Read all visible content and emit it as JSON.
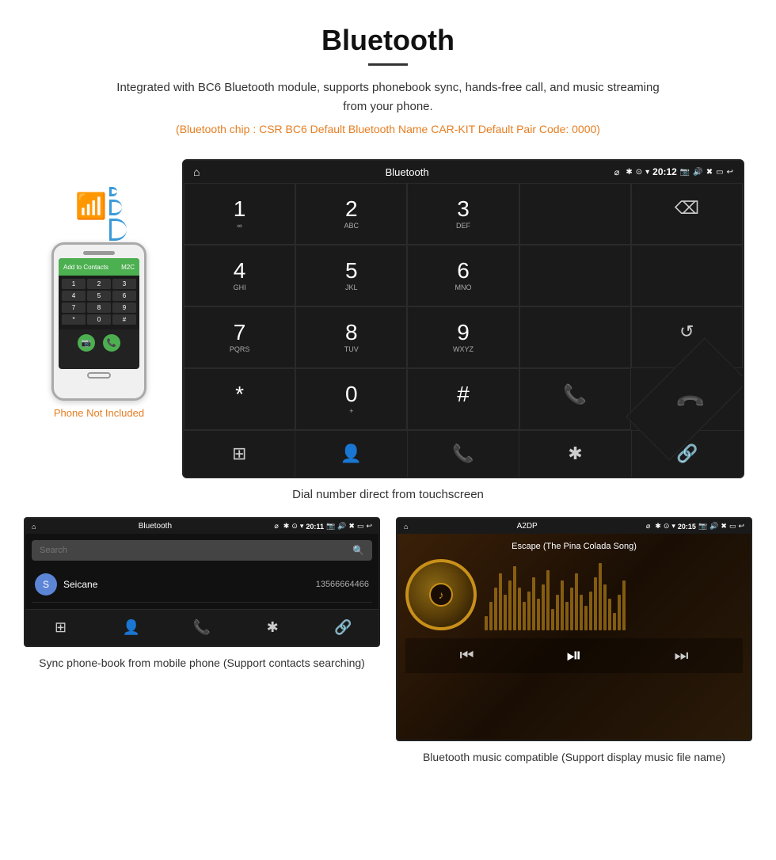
{
  "header": {
    "title": "Bluetooth",
    "description": "Integrated with BC6 Bluetooth module, supports phonebook sync, hands-free call, and music streaming from your phone.",
    "bluetooth_info": "(Bluetooth chip : CSR BC6    Default Bluetooth Name CAR-KIT    Default Pair Code: 0000)"
  },
  "main_screen": {
    "status_bar": {
      "title": "Bluetooth",
      "time": "20:12",
      "usb_icon": "⌀",
      "bt_icon": "✱",
      "location_icon": "⊙",
      "wifi_icon": "▾"
    },
    "dialpad": {
      "keys": [
        {
          "main": "1",
          "sub": "∞"
        },
        {
          "main": "2",
          "sub": "ABC"
        },
        {
          "main": "3",
          "sub": "DEF"
        },
        {
          "main": "",
          "sub": "",
          "type": "empty"
        },
        {
          "main": "⌫",
          "sub": "",
          "type": "backspace"
        },
        {
          "main": "4",
          "sub": "GHI"
        },
        {
          "main": "5",
          "sub": "JKL"
        },
        {
          "main": "6",
          "sub": "MNO"
        },
        {
          "main": "",
          "sub": "",
          "type": "empty"
        },
        {
          "main": "",
          "sub": "",
          "type": "empty"
        },
        {
          "main": "7",
          "sub": "PQRS"
        },
        {
          "main": "8",
          "sub": "TUV"
        },
        {
          "main": "9",
          "sub": "WXYZ"
        },
        {
          "main": "",
          "sub": "",
          "type": "empty"
        },
        {
          "main": "↺",
          "sub": "",
          "type": "reload"
        },
        {
          "main": "*",
          "sub": ""
        },
        {
          "main": "0",
          "sub": "+"
        },
        {
          "main": "#",
          "sub": ""
        },
        {
          "main": "📞",
          "sub": "",
          "type": "call-green"
        },
        {
          "main": "📞",
          "sub": "",
          "type": "call-red"
        }
      ]
    },
    "bottom_nav": [
      "⊞",
      "👤",
      "📞",
      "✱",
      "🔗"
    ]
  },
  "main_caption": "Dial number direct from touchscreen",
  "phone_mockup": {
    "not_included_label": "Phone Not Included",
    "screen_title": "Add to Contacts",
    "contact_name": "M2C",
    "dialpad_keys": [
      [
        "1",
        "2",
        "3"
      ],
      [
        "4",
        "5",
        "6"
      ],
      [
        "7",
        "8",
        "9"
      ],
      [
        "*",
        "0",
        "#"
      ]
    ]
  },
  "phonebook_screen": {
    "status_bar": {
      "title": "Bluetooth",
      "time": "20:11"
    },
    "search_placeholder": "Search",
    "contacts": [
      {
        "initial": "S",
        "name": "Seicane",
        "number": "13566664466"
      }
    ]
  },
  "phonebook_caption": "Sync phone-book from mobile phone\n(Support contacts searching)",
  "music_screen": {
    "status_bar": {
      "title": "A2DP",
      "time": "20:15"
    },
    "song_title": "Escape (The Pina Colada Song)",
    "controls": {
      "prev": "⏮",
      "play_pause": "⏯",
      "next": "⏭"
    }
  },
  "music_caption": "Bluetooth music compatible\n(Support display music file name)",
  "colors": {
    "accent_orange": "#e67e22",
    "android_bg": "#1a1a1a",
    "green_call": "#4CAF50",
    "red_call": "#e74c3c",
    "bt_blue": "#3a9ad9"
  }
}
